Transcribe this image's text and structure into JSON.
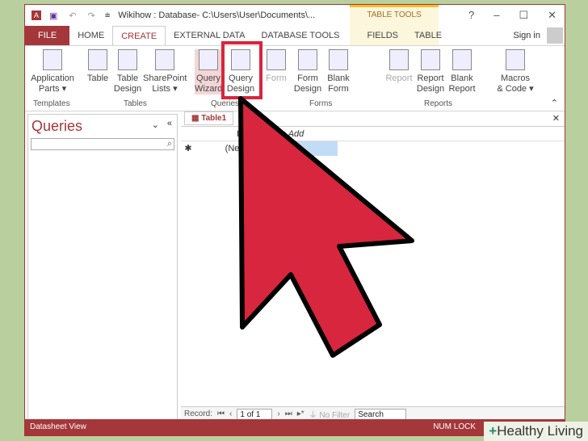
{
  "title": "Wikihow : Database- C:\\Users\\User\\Documents\\...",
  "table_tools": "TABLE TOOLS",
  "window_controls": [
    "?",
    "–",
    "☐",
    "✕"
  ],
  "tabs": [
    "FILE",
    "HOME",
    "CREATE",
    "EXTERNAL DATA",
    "DATABASE TOOLS",
    "FIELDS",
    "TABLE"
  ],
  "sign_in": "Sign in",
  "ribbon": {
    "buttons": [
      "Application Parts ▾",
      "Table",
      "Table Design",
      "SharePoint Lists ▾",
      "Query Wizard",
      "Query Design",
      "Form",
      "Form Design",
      "Blank Form",
      "Report",
      "Report Design",
      "Blank Report",
      "Macros & Code ▾"
    ],
    "groups": [
      "Templates",
      "Tables",
      "Queries",
      "Forms",
      "Reports"
    ]
  },
  "nav": {
    "title": "Queries",
    "search_placeholder": ""
  },
  "doc_tab": "Table1",
  "grid": {
    "columns": [
      "ID",
      "Click to Add"
    ],
    "new_row": "(New)"
  },
  "record_nav": {
    "label": "Record:",
    "position": "1 of 1",
    "filter": "No Filter",
    "search": "Search"
  },
  "status": {
    "view": "Datasheet View",
    "num_lock": "NUM LOCK"
  },
  "watermark": "Healthy Living",
  "colors": {
    "accent": "#a4373a",
    "arrow": "#d7263d",
    "background": "#b9cf9e"
  }
}
